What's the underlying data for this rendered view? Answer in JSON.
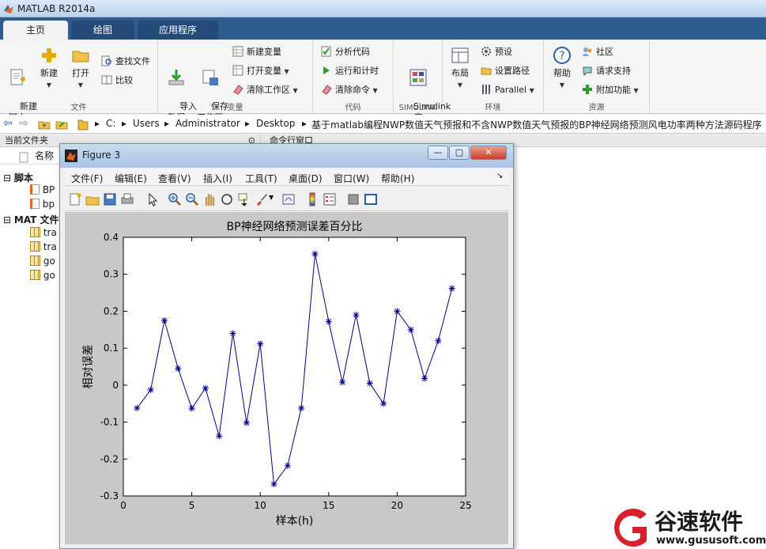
{
  "app": {
    "title": "MATLAB R2014a"
  },
  "tabs": [
    {
      "label": "主页"
    },
    {
      "label": "绘图"
    },
    {
      "label": "应用程序"
    }
  ],
  "ribbon": {
    "file": {
      "label": "文件",
      "new_script": "新建\n脚本",
      "new": "新建",
      "open": "打开",
      "find_files": "查找文件",
      "compare": "比较"
    },
    "variable": {
      "label": "变量",
      "import": "导入\n数据",
      "save_ws": "保存\n工作区",
      "new_var": "新建变量",
      "open_var": "打开变量",
      "clear_ws": "清除工作区"
    },
    "code": {
      "label": "代码",
      "analyze": "分析代码",
      "run_time": "运行和计时",
      "clear_cmd": "清除命令"
    },
    "simulink": {
      "label": "SIMULINK",
      "lib": "Simulink\n库"
    },
    "env": {
      "label": "环境",
      "layout": "布局",
      "prefs": "预设",
      "set_path": "设置路径",
      "parallel": "Parallel"
    },
    "resources": {
      "label": "资源",
      "help": "帮助",
      "community": "社区",
      "support": "请求支持",
      "addons": "附加功能"
    }
  },
  "address": {
    "crumbs": [
      "C:",
      "Users",
      "Administrator",
      "Desktop",
      "基于matlab编程NWP数值天气预报和不含NWP数值天气预报的BP神经网络预测风电功率两种方法源码程序"
    ]
  },
  "left_panel": {
    "title": "当前文件夹",
    "col_name": "名称",
    "scripts_label": "脚本",
    "scripts": [
      "BP",
      "bp"
    ],
    "mat_label": "MAT 文件",
    "mats": [
      "tra",
      "tra",
      "go",
      "go"
    ]
  },
  "cmd_panel": {
    "title": "命令行窗口"
  },
  "figure": {
    "title": "Figure 3",
    "menus": [
      "文件(F)",
      "编辑(E)",
      "查看(V)",
      "插入(I)",
      "工具(T)",
      "桌面(D)",
      "窗口(W)",
      "帮助(H)"
    ]
  },
  "chart_data": {
    "type": "line",
    "title": "BP神经网络预测误差百分比",
    "xlabel": "样本(h)",
    "ylabel": "相对误差",
    "xlim": [
      0,
      25
    ],
    "ylim": [
      -0.3,
      0.4
    ],
    "xticks": [
      0,
      5,
      10,
      15,
      20,
      25
    ],
    "yticks": [
      -0.3,
      -0.2,
      -0.1,
      0,
      0.1,
      0.2,
      0.3,
      0.4
    ],
    "marker": "*",
    "color": "#00008b",
    "x": [
      1,
      2,
      3,
      4,
      5,
      6,
      7,
      8,
      9,
      10,
      11,
      12,
      13,
      14,
      15,
      16,
      17,
      18,
      19,
      20,
      21,
      22,
      23,
      24
    ],
    "y": [
      -0.062,
      -0.013,
      0.175,
      0.045,
      -0.063,
      -0.008,
      -0.138,
      0.14,
      -0.102,
      0.112,
      -0.268,
      -0.218,
      -0.062,
      0.355,
      0.172,
      0.008,
      0.19,
      0.005,
      -0.05,
      0.2,
      0.15,
      0.018,
      0.12,
      0.262
    ]
  },
  "watermark": {
    "brand": "谷速软件",
    "url": "www.gususoft.com"
  }
}
